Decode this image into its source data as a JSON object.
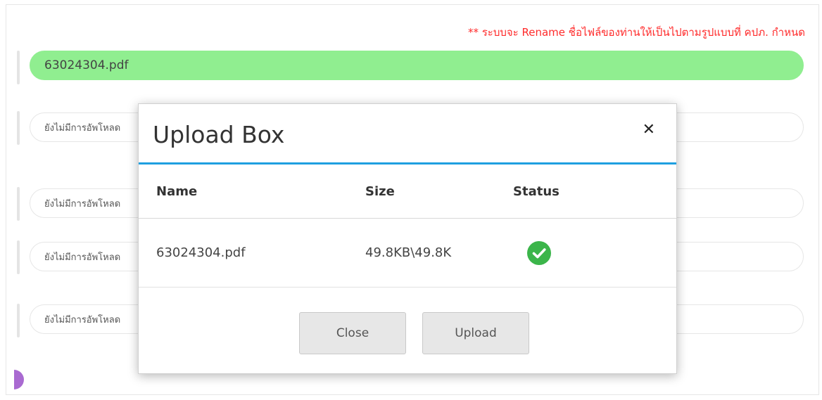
{
  "notice": {
    "rename_note": "** ระบบจะ Rename ชื่อไฟล์ของท่านให้เป็นไปตามรูปแบบที่ คปภ. กำหนด",
    "note_color": "#ff2a2a"
  },
  "upload_slots": [
    {
      "label": "63024304.pdf",
      "state": "uploaded",
      "color": "#90ee90"
    },
    {
      "label": "ยังไม่มีการอัพโหลด",
      "state": "empty"
    },
    {
      "label": "ยังไม่มีการอัพโหลด",
      "state": "empty"
    },
    {
      "label": "ยังไม่มีการอัพโหลด",
      "state": "empty"
    },
    {
      "label": "ยังไม่มีการอัพโหลด",
      "state": "empty"
    }
  ],
  "modal": {
    "title": "Upload Box",
    "close_icon": "close-icon",
    "accent_color": "#1e9fe0",
    "columns": {
      "name": "Name",
      "size": "Size",
      "status": "Status"
    },
    "files": [
      {
        "name": "63024304.pdf",
        "size": "49.8KB\\49.8K",
        "status": "complete",
        "status_icon": "check-circle-icon",
        "status_color": "#3bb54a"
      }
    ],
    "buttons": {
      "close": "Close",
      "upload": "Upload"
    }
  }
}
